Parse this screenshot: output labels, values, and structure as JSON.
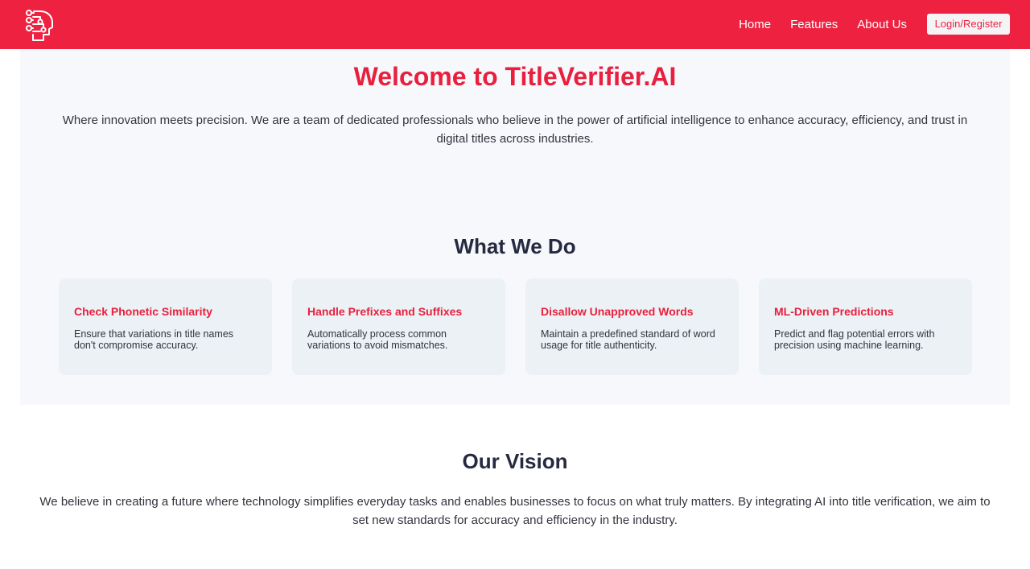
{
  "nav": {
    "links": [
      "Home",
      "Features",
      "About Us"
    ],
    "login_label": "Login/Register",
    "logo_icon": "ai-brain-head-icon"
  },
  "hero": {
    "title": "Welcome to TitleVerifier.AI",
    "text": "Where innovation meets precision. We are a team of dedicated professionals who believe in the power of artificial intelligence to enhance accuracy, efficiency, and trust in digital titles across industries."
  },
  "what_we_do": {
    "title": "What We Do",
    "cards": [
      {
        "title": "Check Phonetic Similarity",
        "text": "Ensure that variations in title names don't compromise accuracy."
      },
      {
        "title": "Handle Prefixes and Suffixes",
        "text": "Automatically process common variations to avoid mismatches."
      },
      {
        "title": "Disallow Unapproved Words",
        "text": "Maintain a predefined standard of word usage for title authenticity."
      },
      {
        "title": "ML-Driven Predictions",
        "text": "Predict and flag potential errors with precision using machine learning."
      }
    ]
  },
  "vision": {
    "title": "Our Vision",
    "text": "We believe in creating a future where technology simplifies everyday tasks and enables businesses to focus on what truly matters. By integrating AI into title verification, we aim to set new standards for accuracy and efficiency in the industry."
  },
  "colors": {
    "brand_red": "#ee2240",
    "heading_dark": "#262a40",
    "panel_bg": "#f7f8fc",
    "card_bg": "#ebf1f4"
  }
}
